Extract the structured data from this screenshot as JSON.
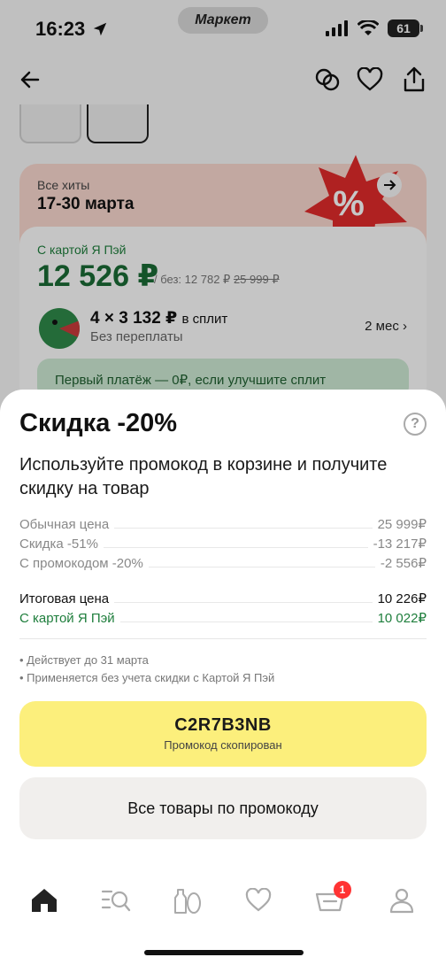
{
  "status_bar": {
    "time": "16:23",
    "app_pill": "Маркет",
    "battery": "61"
  },
  "promo_banner": {
    "caption": "Все хиты",
    "dates": "17-30 марта"
  },
  "price_block": {
    "card_label": "С картой Я Пэй",
    "card_price": "12 526 ₽",
    "without_prefix": "/ без:",
    "without_price": "12 782 ₽",
    "old_price": "25 999 ₽",
    "split_amount": "4 × 3 132 ₽",
    "split_suffix": "в сплит",
    "split_sub": "Без переплаты",
    "split_months": "2 мес",
    "green_banner": "Первый платёж — 0₽, если улучшите сплит"
  },
  "sheet": {
    "title": "Скидка -20%",
    "help": "?",
    "subtitle": "Используйте промокод в корзине и получите скидку на товар",
    "rows": [
      {
        "label": "Обычная цена",
        "value": "25 999₽"
      },
      {
        "label": "Скидка -51%",
        "value": "-13 217₽"
      },
      {
        "label": "С промокодом -20%",
        "value": "-2 556₽"
      }
    ],
    "total": {
      "label": "Итоговая цена",
      "value": "10 226₽"
    },
    "card_total": {
      "label": "С картой Я Пэй",
      "value": "10 022₽"
    },
    "notes": [
      "• Действует до 31 марта",
      "• Применяется без учета скидки с Картой Я Пэй"
    ],
    "promo_code": "C2R7B3NB",
    "promo_copied": "Промокод скопирован",
    "all_products_button": "Все товары по промокоду"
  },
  "tabbar": {
    "cart_badge": "1"
  },
  "colors": {
    "accent_yellow": "#fcef7c",
    "pay_green": "#1e7e3c",
    "badge_red": "#ff3333"
  }
}
